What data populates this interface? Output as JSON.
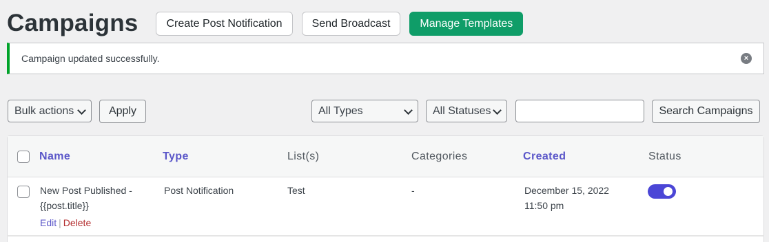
{
  "page": {
    "title": "Campaigns",
    "buttons": {
      "create_post_notification": "Create Post Notification",
      "send_broadcast": "Send Broadcast",
      "manage_templates": "Manage Templates"
    }
  },
  "notice": {
    "message": "Campaign updated successfully.",
    "dismiss_icon": "close-circle-icon",
    "accent_color": "#00a32a"
  },
  "toolbar": {
    "bulk_actions": {
      "selected": "Bulk actions"
    },
    "apply_label": "Apply",
    "type_filter": {
      "selected": "All Types"
    },
    "status_filter": {
      "selected": "All Statuses"
    },
    "search": {
      "value": "",
      "placeholder": ""
    },
    "search_button": "Search Campaigns"
  },
  "table": {
    "columns": {
      "name": "Name",
      "type": "Type",
      "lists": "List(s)",
      "categories": "Categories",
      "created": "Created",
      "status": "Status"
    },
    "rows": [
      {
        "name_line1": "New Post Published -",
        "name_line2": "{{post.title}}",
        "type": "Post Notification",
        "lists": "Test",
        "categories": "-",
        "created_line1": "December 15, 2022",
        "created_line2": "11:50 pm",
        "status_enabled": true,
        "actions": {
          "edit": "Edit",
          "separator": "|",
          "delete": "Delete"
        }
      }
    ]
  },
  "colors": {
    "primary_button": "#0f9d68",
    "sortable_header": "#5b57c9",
    "toggle_on": "#4b46d6",
    "delete_link": "#b32d2e"
  }
}
